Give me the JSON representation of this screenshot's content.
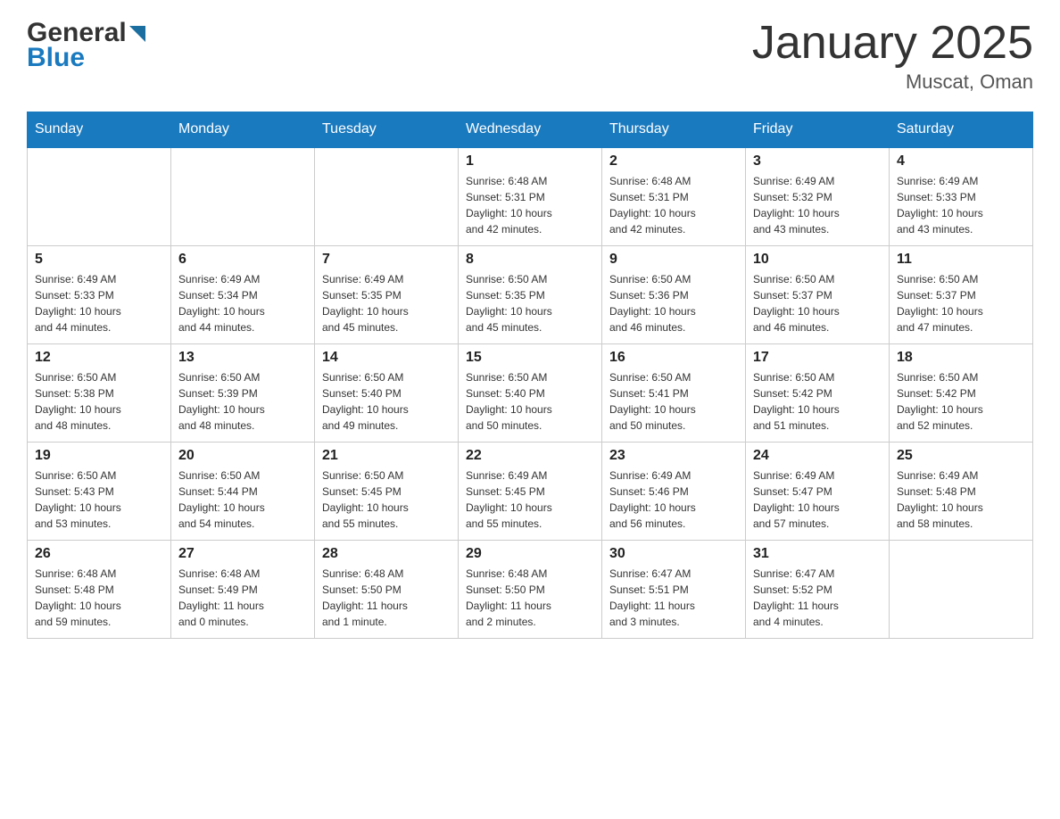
{
  "header": {
    "title": "January 2025",
    "location": "Muscat, Oman"
  },
  "weekdays": [
    "Sunday",
    "Monday",
    "Tuesday",
    "Wednesday",
    "Thursday",
    "Friday",
    "Saturday"
  ],
  "weeks": [
    [
      {
        "day": "",
        "info": ""
      },
      {
        "day": "",
        "info": ""
      },
      {
        "day": "",
        "info": ""
      },
      {
        "day": "1",
        "info": "Sunrise: 6:48 AM\nSunset: 5:31 PM\nDaylight: 10 hours\nand 42 minutes."
      },
      {
        "day": "2",
        "info": "Sunrise: 6:48 AM\nSunset: 5:31 PM\nDaylight: 10 hours\nand 42 minutes."
      },
      {
        "day": "3",
        "info": "Sunrise: 6:49 AM\nSunset: 5:32 PM\nDaylight: 10 hours\nand 43 minutes."
      },
      {
        "day": "4",
        "info": "Sunrise: 6:49 AM\nSunset: 5:33 PM\nDaylight: 10 hours\nand 43 minutes."
      }
    ],
    [
      {
        "day": "5",
        "info": "Sunrise: 6:49 AM\nSunset: 5:33 PM\nDaylight: 10 hours\nand 44 minutes."
      },
      {
        "day": "6",
        "info": "Sunrise: 6:49 AM\nSunset: 5:34 PM\nDaylight: 10 hours\nand 44 minutes."
      },
      {
        "day": "7",
        "info": "Sunrise: 6:49 AM\nSunset: 5:35 PM\nDaylight: 10 hours\nand 45 minutes."
      },
      {
        "day": "8",
        "info": "Sunrise: 6:50 AM\nSunset: 5:35 PM\nDaylight: 10 hours\nand 45 minutes."
      },
      {
        "day": "9",
        "info": "Sunrise: 6:50 AM\nSunset: 5:36 PM\nDaylight: 10 hours\nand 46 minutes."
      },
      {
        "day": "10",
        "info": "Sunrise: 6:50 AM\nSunset: 5:37 PM\nDaylight: 10 hours\nand 46 minutes."
      },
      {
        "day": "11",
        "info": "Sunrise: 6:50 AM\nSunset: 5:37 PM\nDaylight: 10 hours\nand 47 minutes."
      }
    ],
    [
      {
        "day": "12",
        "info": "Sunrise: 6:50 AM\nSunset: 5:38 PM\nDaylight: 10 hours\nand 48 minutes."
      },
      {
        "day": "13",
        "info": "Sunrise: 6:50 AM\nSunset: 5:39 PM\nDaylight: 10 hours\nand 48 minutes."
      },
      {
        "day": "14",
        "info": "Sunrise: 6:50 AM\nSunset: 5:40 PM\nDaylight: 10 hours\nand 49 minutes."
      },
      {
        "day": "15",
        "info": "Sunrise: 6:50 AM\nSunset: 5:40 PM\nDaylight: 10 hours\nand 50 minutes."
      },
      {
        "day": "16",
        "info": "Sunrise: 6:50 AM\nSunset: 5:41 PM\nDaylight: 10 hours\nand 50 minutes."
      },
      {
        "day": "17",
        "info": "Sunrise: 6:50 AM\nSunset: 5:42 PM\nDaylight: 10 hours\nand 51 minutes."
      },
      {
        "day": "18",
        "info": "Sunrise: 6:50 AM\nSunset: 5:42 PM\nDaylight: 10 hours\nand 52 minutes."
      }
    ],
    [
      {
        "day": "19",
        "info": "Sunrise: 6:50 AM\nSunset: 5:43 PM\nDaylight: 10 hours\nand 53 minutes."
      },
      {
        "day": "20",
        "info": "Sunrise: 6:50 AM\nSunset: 5:44 PM\nDaylight: 10 hours\nand 54 minutes."
      },
      {
        "day": "21",
        "info": "Sunrise: 6:50 AM\nSunset: 5:45 PM\nDaylight: 10 hours\nand 55 minutes."
      },
      {
        "day": "22",
        "info": "Sunrise: 6:49 AM\nSunset: 5:45 PM\nDaylight: 10 hours\nand 55 minutes."
      },
      {
        "day": "23",
        "info": "Sunrise: 6:49 AM\nSunset: 5:46 PM\nDaylight: 10 hours\nand 56 minutes."
      },
      {
        "day": "24",
        "info": "Sunrise: 6:49 AM\nSunset: 5:47 PM\nDaylight: 10 hours\nand 57 minutes."
      },
      {
        "day": "25",
        "info": "Sunrise: 6:49 AM\nSunset: 5:48 PM\nDaylight: 10 hours\nand 58 minutes."
      }
    ],
    [
      {
        "day": "26",
        "info": "Sunrise: 6:48 AM\nSunset: 5:48 PM\nDaylight: 10 hours\nand 59 minutes."
      },
      {
        "day": "27",
        "info": "Sunrise: 6:48 AM\nSunset: 5:49 PM\nDaylight: 11 hours\nand 0 minutes."
      },
      {
        "day": "28",
        "info": "Sunrise: 6:48 AM\nSunset: 5:50 PM\nDaylight: 11 hours\nand 1 minute."
      },
      {
        "day": "29",
        "info": "Sunrise: 6:48 AM\nSunset: 5:50 PM\nDaylight: 11 hours\nand 2 minutes."
      },
      {
        "day": "30",
        "info": "Sunrise: 6:47 AM\nSunset: 5:51 PM\nDaylight: 11 hours\nand 3 minutes."
      },
      {
        "day": "31",
        "info": "Sunrise: 6:47 AM\nSunset: 5:52 PM\nDaylight: 11 hours\nand 4 minutes."
      },
      {
        "day": "",
        "info": ""
      }
    ]
  ]
}
